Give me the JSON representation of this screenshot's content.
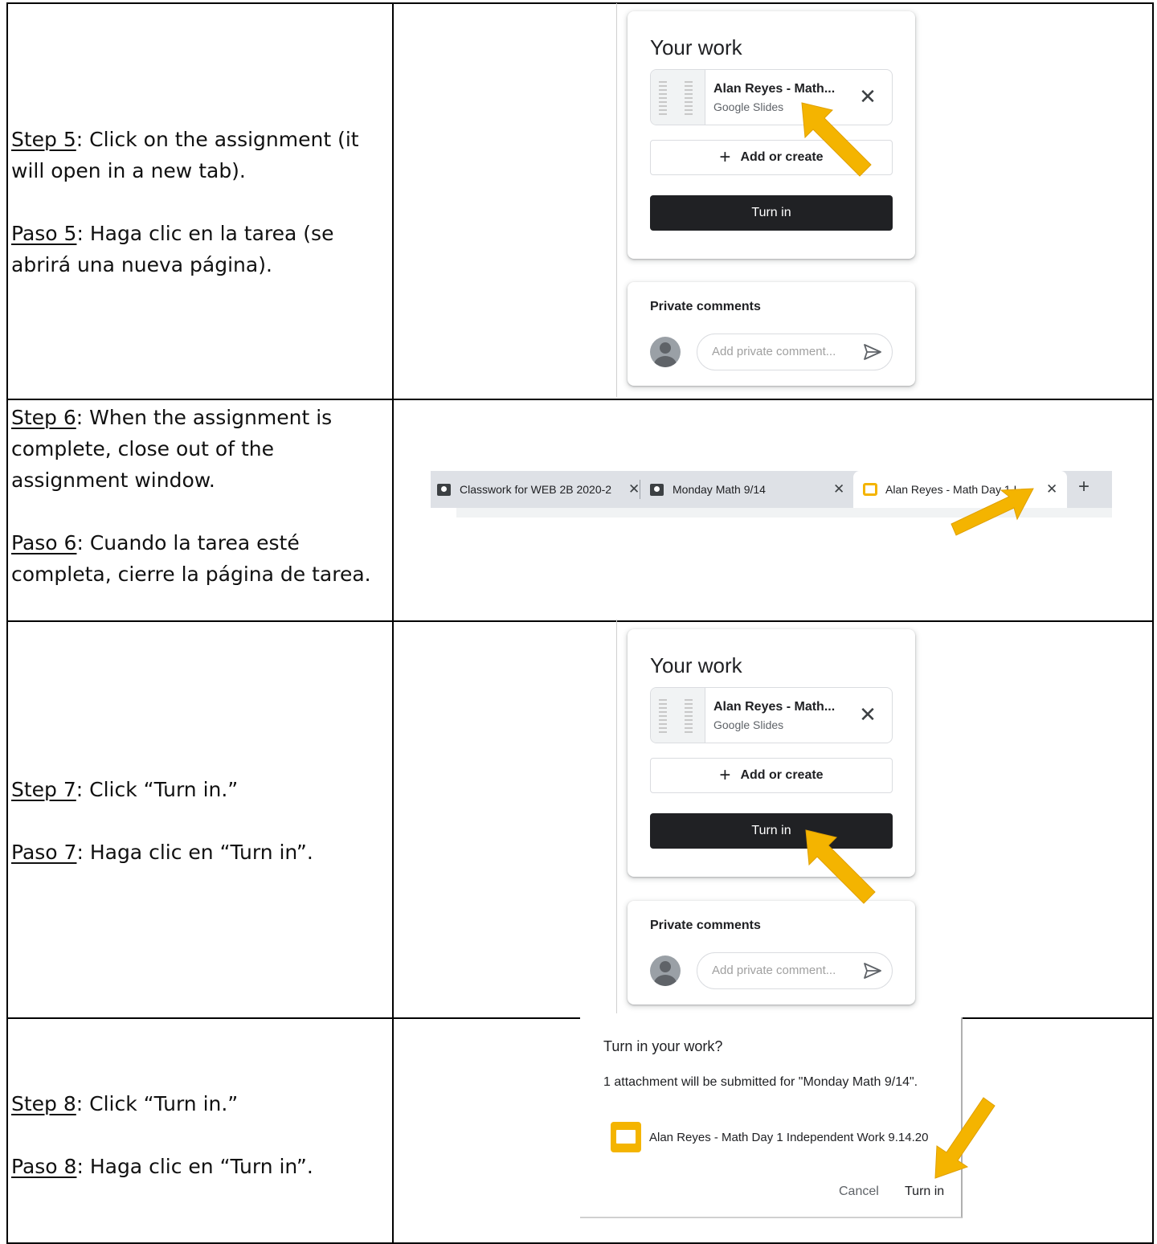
{
  "rows": [
    {
      "en_step": "Step 5",
      "en_text": ": Click on the assignment (it will open in a new tab).",
      "es_step": "Paso 5",
      "es_text": ": Haga clic en la tarea (se abrirá una nueva página)."
    },
    {
      "en_step": "Step 6",
      "en_text": ": When the assignment is complete, close out of the assignment window.",
      "es_step": "Paso 6",
      "es_text": ": Cuando la tarea esté completa, cierre la página de tarea."
    },
    {
      "en_step": "Step 7",
      "en_text": ": Click “Turn in.”",
      "es_step": "Paso 7",
      "es_text": ": Haga clic en “Turn in”."
    },
    {
      "en_step": "Step 8",
      "en_text": ": Click “Turn in.”",
      "es_step": "Paso 8",
      "es_text": ": Haga clic en “Turn in”."
    }
  ],
  "work_card": {
    "title": "Your work",
    "attachment_name": "Alan Reyes - Math...",
    "attachment_type": "Google Slides",
    "add_label": "Add or create",
    "turn_in_label": "Turn in"
  },
  "comments_card": {
    "title": "Private comments",
    "placeholder": "Add private comment..."
  },
  "tabs": [
    {
      "label": "Classwork for WEB 2B 2020-2"
    },
    {
      "label": "Monday Math 9/14"
    },
    {
      "label": "Alan Reyes - Math Day 1 I"
    }
  ],
  "dialog": {
    "title": "Turn in your work?",
    "body": "1 attachment will be submitted for \"Monday Math 9/14\".",
    "file_name": "Alan Reyes - Math Day 1 Independent Work 9.14.20",
    "cancel_label": "Cancel",
    "turn_in_label": "Turn in"
  },
  "colors": {
    "arrow": "#f4b400",
    "button_dark": "#202124",
    "slides_yellow": "#f4b400"
  },
  "icons": {
    "close": "close-icon",
    "add": "plus-icon",
    "send": "send-icon",
    "avatar": "avatar-icon",
    "slides": "google-slides-icon",
    "classroom": "classroom-icon"
  }
}
